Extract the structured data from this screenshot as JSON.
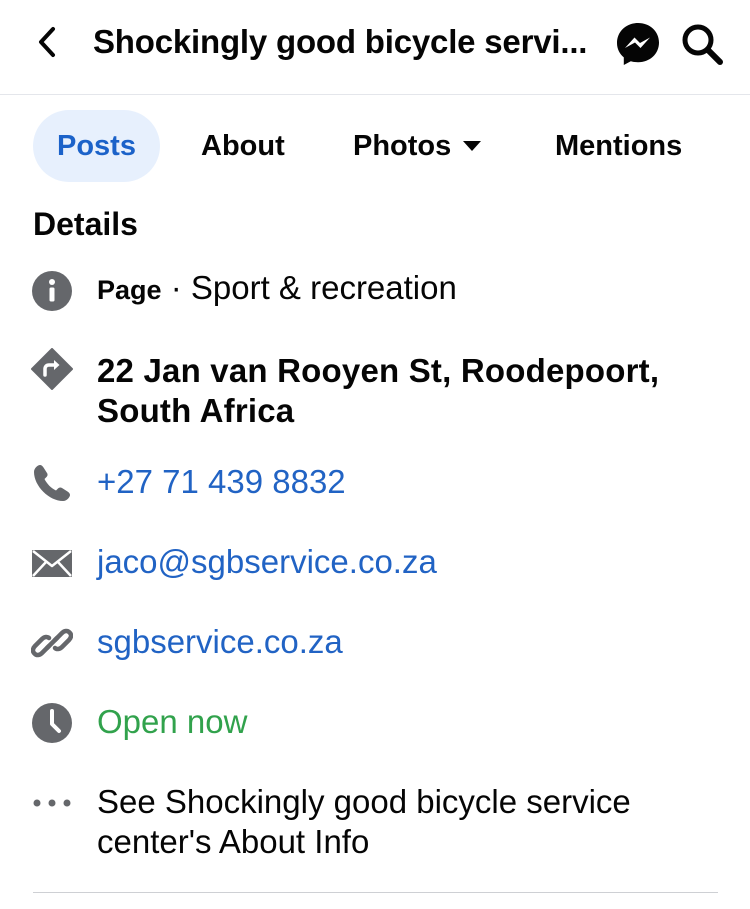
{
  "header": {
    "title": "Shockingly good bicycle servi..."
  },
  "tabs": [
    {
      "label": "Posts",
      "active": true
    },
    {
      "label": "About",
      "active": false
    },
    {
      "label": "Photos",
      "active": false
    },
    {
      "label": "Mentions",
      "active": false
    }
  ],
  "details": {
    "heading": "Details",
    "category_prefix": "Page",
    "category_separator": " · ",
    "category": "Sport & recreation",
    "address": "22 Jan van Rooyen St, Roodepoort, South Africa",
    "phone": "+27 71 439 8832",
    "email": "jaco@sgbservice.co.za",
    "website": "sgbservice.co.za",
    "hours_status": "Open now",
    "see_about": "See Shockingly good bicycle service center's About Info"
  },
  "icons": {
    "back": "chevron-left-icon",
    "messenger": "messenger-icon",
    "search": "search-icon",
    "info": "info-icon",
    "directions": "directions-icon",
    "phone": "phone-icon",
    "email": "envelope-icon",
    "link": "link-icon",
    "clock": "clock-icon",
    "more": "more-dots-icon"
  },
  "colors": {
    "link": "#2163c4",
    "open": "#31a24c",
    "active_tab_bg": "#e7f0fd",
    "active_tab_text": "#1b62c9",
    "icon_gray": "#65676b"
  }
}
